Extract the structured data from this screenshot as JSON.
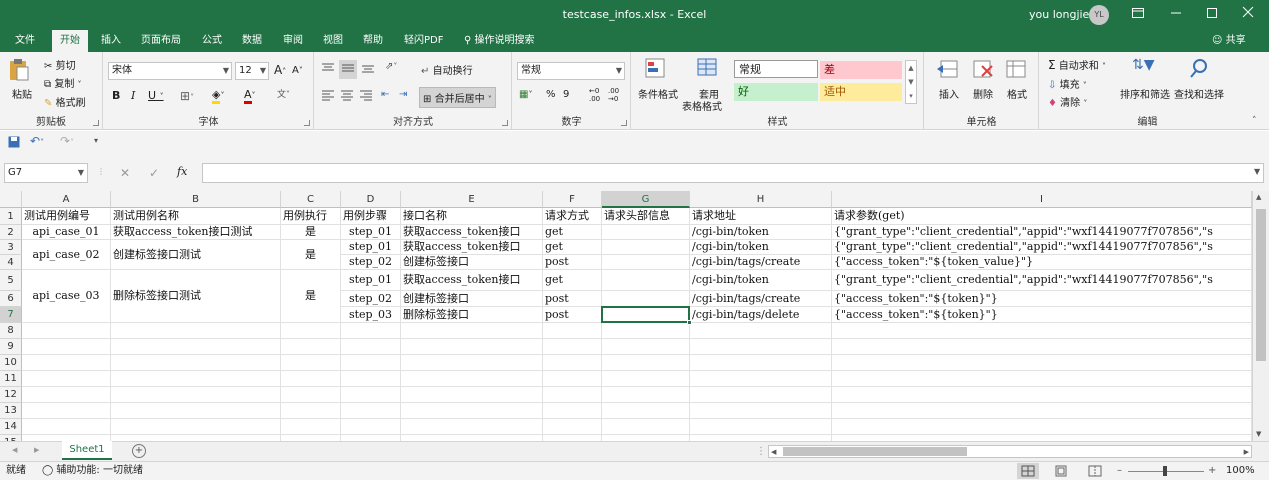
{
  "window": {
    "title": "testcase_infos.xlsx  -  Excel",
    "user_name": "you longjie",
    "user_initials": "YL",
    "accent_color": "#217346"
  },
  "menu_tabs": [
    "文件",
    "开始",
    "插入",
    "页面布局",
    "公式",
    "数据",
    "审阅",
    "视图",
    "帮助",
    "轻闪PDF"
  ],
  "active_tab": "开始",
  "tell_me": "操作说明搜索",
  "share": "共享",
  "ribbon": {
    "clipboard": {
      "paste": "粘贴",
      "cut": "剪切",
      "copy": "复制",
      "format_painter": "格式刷",
      "label": "剪贴板"
    },
    "font": {
      "name": "宋体",
      "size": "12",
      "label": "字体"
    },
    "alignment": {
      "wrap": "自动换行",
      "merge": "合并后居中",
      "label": "对齐方式"
    },
    "number": {
      "format": "常规",
      "percent": "%",
      "comma": "9",
      "label": "数字"
    },
    "styles": {
      "conditional": "条件格式",
      "table_format_1": "套用",
      "table_format_2": "表格格式",
      "normal": "常规",
      "bad": "差",
      "good": "好",
      "neutral": "适中",
      "label": "样式"
    },
    "cells": {
      "insert": "插入",
      "delete": "删除",
      "format": "格式",
      "label": "单元格"
    },
    "editing": {
      "autosum": "自动求和",
      "fill": "填充",
      "clear": "清除",
      "sort_filter": "排序和筛选",
      "find_select": "查找和选择",
      "label": "编辑"
    }
  },
  "formula_bar": {
    "name_box": "G7",
    "fx": "fx",
    "value": ""
  },
  "sheet": {
    "columns": [
      "A",
      "B",
      "C",
      "D",
      "E",
      "F",
      "G",
      "H",
      "I"
    ],
    "rows": [
      "1",
      "2",
      "3",
      "4",
      "5",
      "6",
      "7",
      "8",
      "9",
      "10",
      "11",
      "12",
      "13",
      "14",
      "15"
    ],
    "headers": [
      "测试用例编号",
      "测试用例名称",
      "用例执行",
      "用例步骤",
      "接口名称",
      "请求方式",
      "请求头部信息",
      "请求地址",
      "请求参数(get)"
    ],
    "cases": [
      {
        "id": "api_case_01",
        "name": "获取access_token接口测试",
        "exec": "是"
      },
      {
        "id": "api_case_02",
        "name": "创建标签接口测试",
        "exec": "是"
      },
      {
        "id": "api_case_03",
        "name": "删除标签接口测试",
        "exec": "是"
      }
    ],
    "steps": [
      {
        "step": "step_01",
        "api": "获取access_token接口",
        "method": "get",
        "url": "/cgi-bin/token",
        "params": "{\"grant_type\":\"client_credential\",\"appid\":\"wxf14419077f707856\",\"s"
      },
      {
        "step": "step_01",
        "api": "获取access_token接口",
        "method": "get",
        "url": "/cgi-bin/token",
        "params": "{\"grant_type\":\"client_credential\",\"appid\":\"wxf14419077f707856\",\"s"
      },
      {
        "step": "step_02",
        "api": "创建标签接口",
        "method": "post",
        "url": "/cgi-bin/tags/create",
        "params": "{\"access_token\":\"${token_value}\"}"
      },
      {
        "step": "step_01",
        "api": "获取access_token接口",
        "method": "get",
        "url": "/cgi-bin/token",
        "params": "{\"grant_type\":\"client_credential\",\"appid\":\"wxf14419077f707856\",\"s"
      },
      {
        "step": "step_02",
        "api": "创建标签接口",
        "method": "post",
        "url": "/cgi-bin/tags/create",
        "params": "{\"access_token\":\"${token}\"}"
      },
      {
        "step": "step_03",
        "api": "删除标签接口",
        "method": "post",
        "url": "/cgi-bin/tags/delete",
        "params": "{\"access_token\":\"${token}\"}"
      }
    ],
    "selected_cell": "G7"
  },
  "sheet_tabs": [
    "Sheet1"
  ],
  "status": {
    "ready": "就绪",
    "accessibility": "辅助功能: 一切就绪",
    "zoom": "100%"
  }
}
